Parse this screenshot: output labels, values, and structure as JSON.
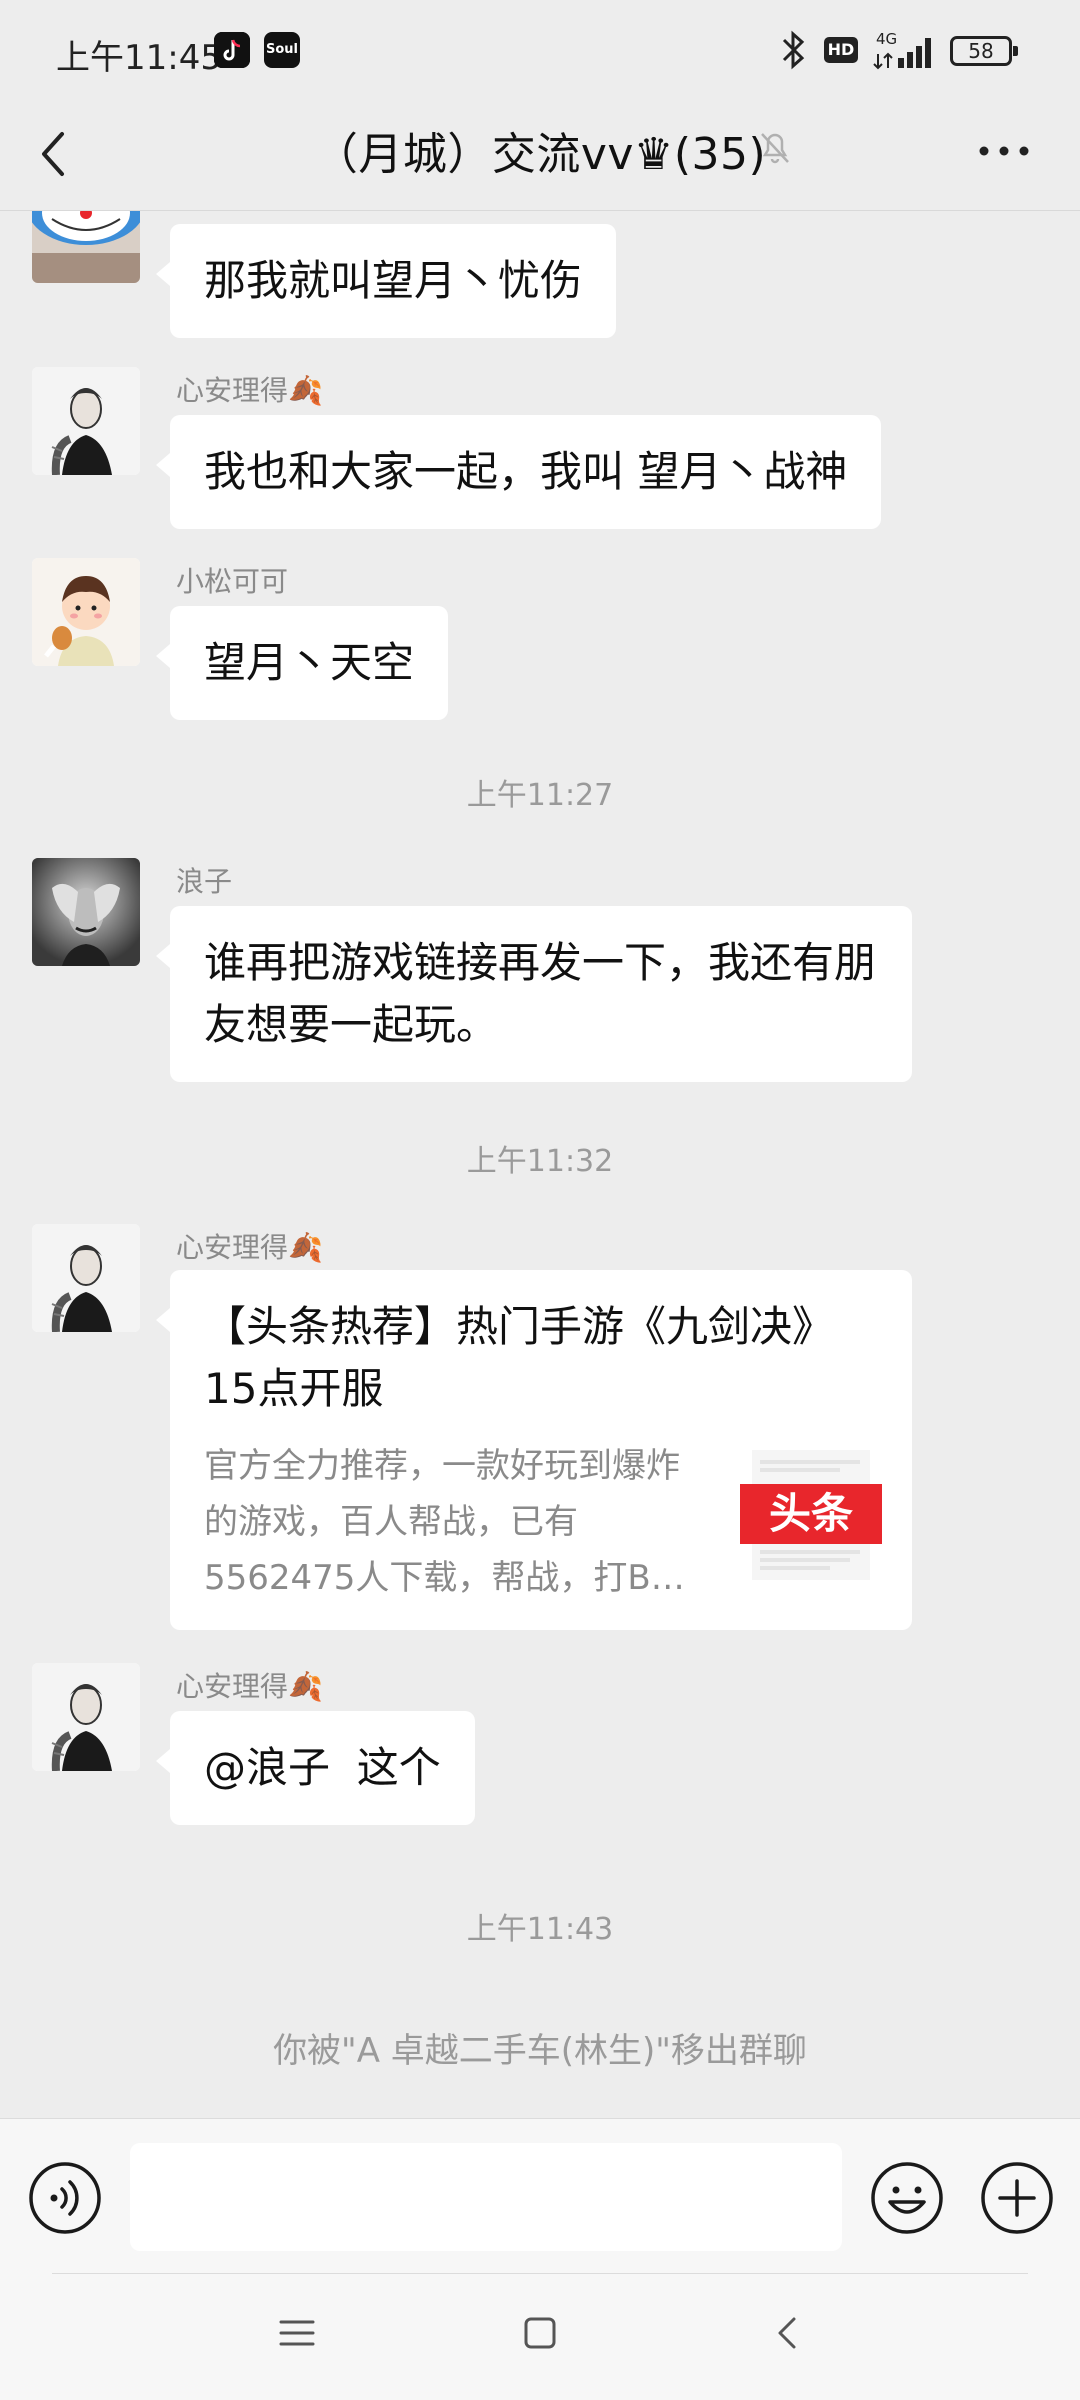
{
  "status_bar": {
    "time": "上午11:45",
    "apps": [
      "tiktok-icon",
      "soul-icon"
    ],
    "soul_label": "Soul",
    "hd_label": "HD",
    "network_label": "4G",
    "battery": "58"
  },
  "header": {
    "title": "（月城）交流vv♛(35)",
    "back_icon": "chevron-left-icon",
    "mute_icon": "bell-off-icon",
    "more_icon": "more-dots-icon"
  },
  "messages": [
    {
      "sender": "",
      "text": "那我就叫望月丶忧伤",
      "avatar": "doraemon-avatar"
    },
    {
      "sender": "心安理得🍂",
      "text": "我也和大家一起，我叫 望月丶战神",
      "avatar": "tattooed-man-avatar"
    },
    {
      "sender": "小松可可",
      "text": "望月丶天空",
      "avatar": "cartoon-boy-avatar"
    },
    {
      "timestamp": "上午11:27"
    },
    {
      "sender": "浪子",
      "text": "谁再把游戏链接再发一下，我还有朋友想要一起玩。",
      "avatar": "stressed-man-avatar"
    },
    {
      "timestamp": "上午11:32"
    },
    {
      "sender": "心安理得🍂",
      "card": {
        "title": "【头条热荐】热门手游《九剑决》15点开服",
        "desc": "官方全力推荐，一款好玩到爆炸的游戏，百人帮战，已有5562475人下载，帮战，打B…",
        "thumb_label": "头条"
      },
      "avatar": "tattooed-man-avatar"
    },
    {
      "sender": "心安理得🍂",
      "text": "@浪子  这个",
      "avatar": "tattooed-man-avatar"
    },
    {
      "timestamp": "上午11:43"
    }
  ],
  "system_message": "你被\"A 卓越二手车(林生)\"移出群聊",
  "input_bar": {
    "placeholder": "",
    "voice_icon": "voice-icon",
    "emoji_icon": "emoji-icon",
    "plus_icon": "plus-icon"
  },
  "nav_bar": {
    "icons": [
      "menu-icon",
      "home-icon",
      "back-icon"
    ]
  },
  "colors": {
    "background": "#ededed",
    "bubble": "#ffffff",
    "timestamp": "#9a9a9a",
    "toutiao_red": "#e8262c"
  }
}
